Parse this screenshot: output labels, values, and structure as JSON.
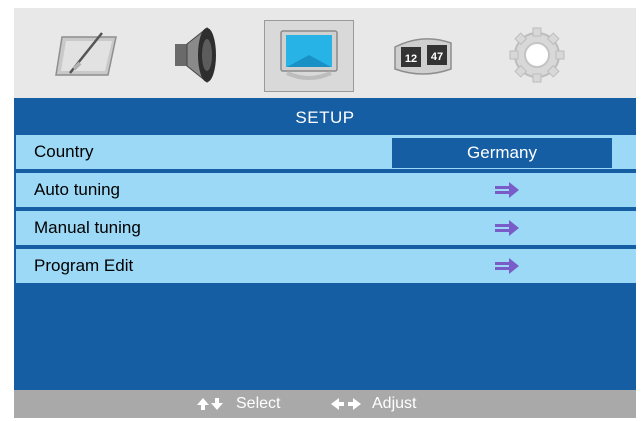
{
  "icon_tabs": [
    {
      "name": "picture",
      "icon": "picture-icon",
      "active": false
    },
    {
      "name": "sound",
      "icon": "speaker-icon",
      "active": false
    },
    {
      "name": "setup",
      "icon": "tv-screen-icon",
      "active": true
    },
    {
      "name": "channel",
      "icon": "channel-number-icon",
      "active": false,
      "glyphs": [
        "12",
        "47"
      ]
    },
    {
      "name": "options",
      "icon": "gear-icon",
      "active": false
    }
  ],
  "menu": {
    "title": "SETUP",
    "items": [
      {
        "label": "Country",
        "value": "Germany",
        "icon": "value-box"
      },
      {
        "label": "Auto tuning",
        "icon": "right-arrow-icon"
      },
      {
        "label": "Manual tuning",
        "icon": "right-arrow-icon"
      },
      {
        "label": "Program Edit",
        "icon": "right-arrow-icon"
      }
    ]
  },
  "footer": {
    "select_label": "Select",
    "adjust_label": "Adjust",
    "select_icon": "up-down-arrows-icon",
    "adjust_icon": "left-right-arrows-icon"
  },
  "colors": {
    "panel_blue": "#155ea4",
    "row_light_blue": "#9bd9f6",
    "footer_gray": "#a9a9a9",
    "icon_bar_gray": "#e8e8e8"
  }
}
